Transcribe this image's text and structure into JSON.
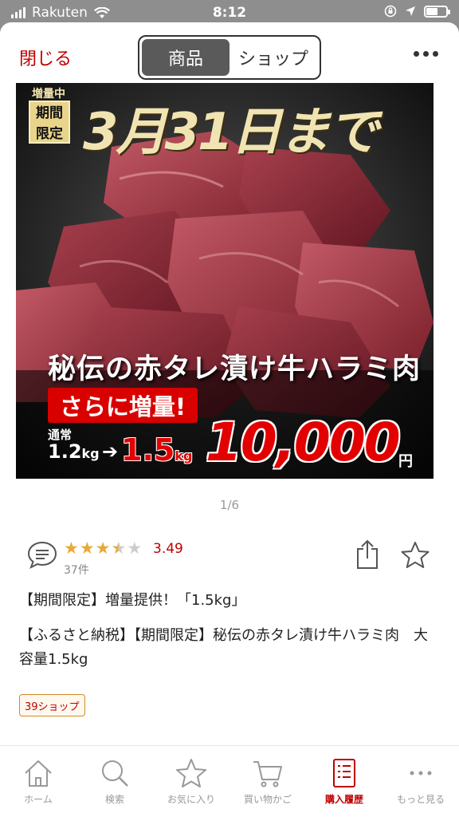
{
  "status_bar": {
    "carrier": "Rakuten",
    "time": "8:12"
  },
  "header": {
    "close_label": "閉じる",
    "segments": [
      "商品",
      "ショップ"
    ],
    "active_segment": "商品"
  },
  "hero": {
    "badge_small": "増量中",
    "badge_line1": "期間",
    "badge_line2": "限定",
    "date_text": "3月31日まで",
    "title": "秘伝の赤タレ漬け牛ハラミ肉",
    "increase_label": "さらに増量!",
    "normal_label": "通常",
    "weight_old": "1.2",
    "weight_old_unit": "kg",
    "arrow": "➔",
    "weight_new": "1.5",
    "weight_new_unit": "kg",
    "price": "10,000",
    "yen": "円"
  },
  "pager": "1/6",
  "rating": {
    "value": "3.49",
    "stars": 3.49,
    "count": "37件"
  },
  "promo_text": "【期間限定】増量提供！「1.5kg」",
  "product_title": "【ふるさと納税】【期間限定】秘伝の赤タレ漬け牛ハラミ肉　大容量1.5kg",
  "shop_badge": "39ショップ",
  "tabs": [
    {
      "label": "ホーム",
      "icon": "home-icon"
    },
    {
      "label": "検索",
      "icon": "search-icon"
    },
    {
      "label": "お気に入り",
      "icon": "star-icon"
    },
    {
      "label": "買い物かご",
      "icon": "cart-icon"
    },
    {
      "label": "購入履歴",
      "icon": "history-icon"
    },
    {
      "label": "もっと見る",
      "icon": "more-icon"
    }
  ],
  "active_tab": "購入履歴",
  "colors": {
    "brand": "#bf0000",
    "star": "#e8a93a",
    "star_empty": "#cccccc"
  }
}
